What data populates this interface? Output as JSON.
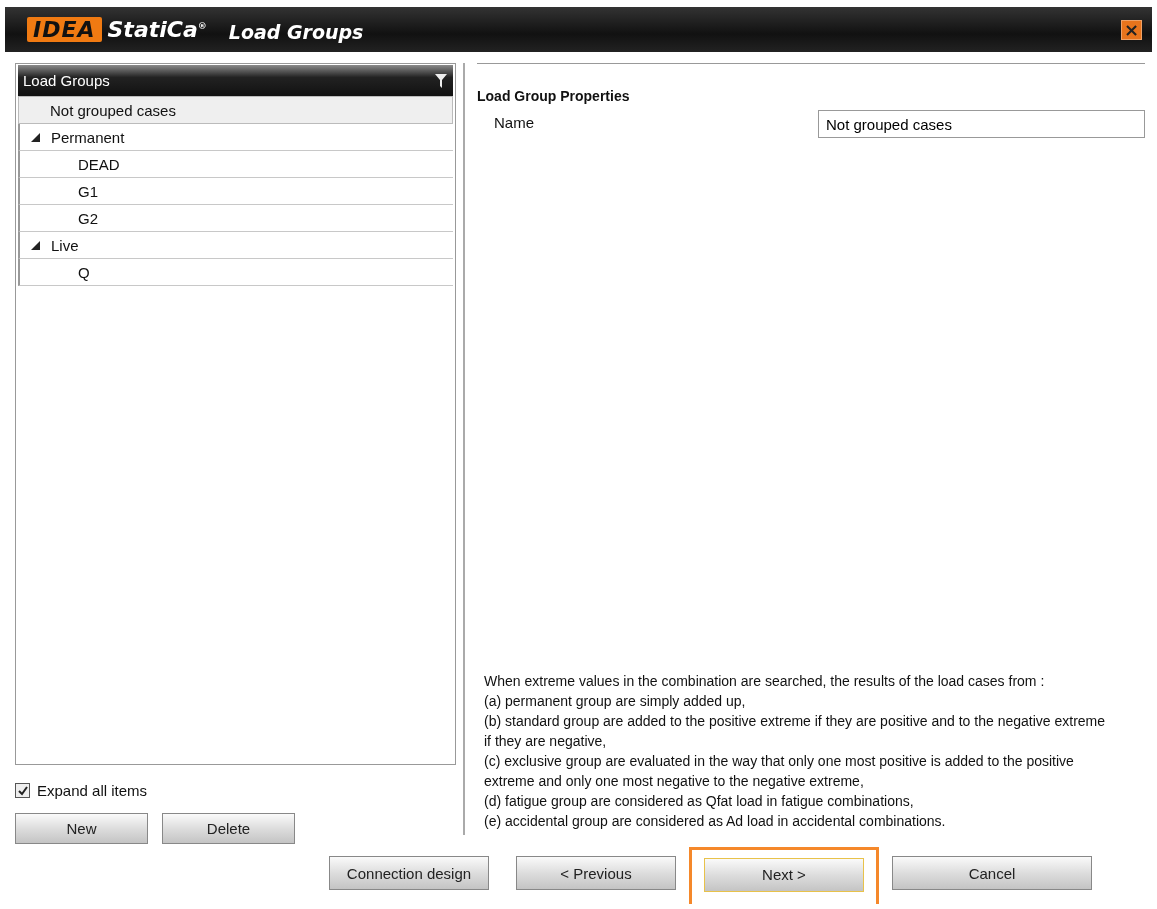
{
  "window": {
    "logo": "IDEA",
    "brand": "StatiCa",
    "brand_mark": "®",
    "title": "Load Groups",
    "close": "×"
  },
  "tree": {
    "header": "Load Groups",
    "items": [
      {
        "label": "Not grouped cases",
        "selected": true
      },
      {
        "label": "Permanent",
        "selected": false,
        "expanded": true,
        "children": [
          {
            "label": "DEAD",
            "selected": false
          },
          {
            "label": "G1",
            "selected": false
          },
          {
            "label": "G2",
            "selected": false
          }
        ]
      },
      {
        "label": "Live",
        "selected": false,
        "expanded": true,
        "children": [
          {
            "label": "Q",
            "selected": false
          }
        ]
      }
    ]
  },
  "expand_all": {
    "label": "Expand all items",
    "checked": true
  },
  "tree_buttons": [
    "New",
    "Delete"
  ],
  "properties": {
    "heading": "Load Group Properties",
    "name_label": "Name",
    "name_value": "Not grouped cases"
  },
  "description": [
    "When extreme values in the combination are searched, the results of the load cases from :",
    "(a) permanent group are simply added up,",
    "(b) standard group are added to the positive extreme if they are positive and to the negative extreme if they are negative,",
    "(c) exclusive group are evaluated in the way that only one most positive is added to the positive extreme and only one most negative to the negative extreme,",
    "(d) fatigue group are considered as Qfat load in fatigue combinations,",
    "(e) accidental group are considered as Ad load in accidental combinations."
  ],
  "footer_buttons": [
    {
      "label": "Connection design",
      "highlighted": false
    },
    {
      "label": "< Previous",
      "highlighted": false
    },
    {
      "label": "Next >",
      "highlighted": true
    },
    {
      "label": "Cancel",
      "highlighted": false
    }
  ]
}
